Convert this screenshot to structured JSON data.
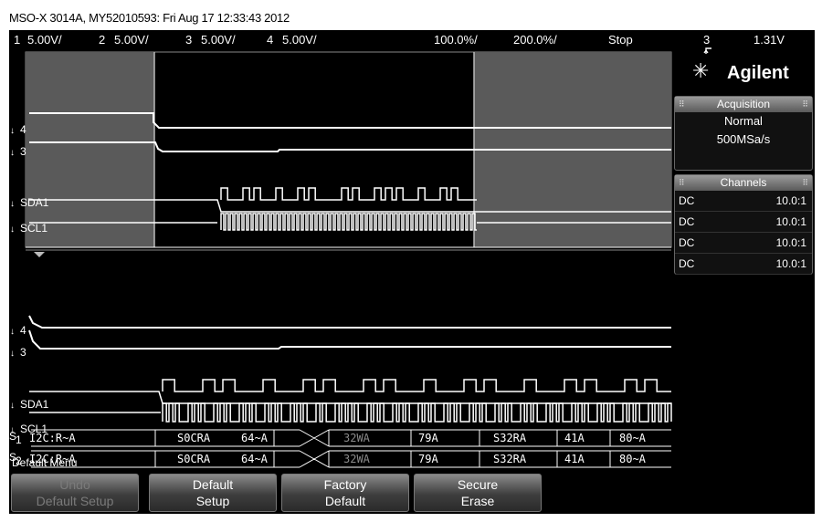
{
  "window": {
    "caption": "MSO-X 3014A, MY52010593: Fri Aug 17 12:33:43 2012"
  },
  "status_bar": {
    "ch1_num": "1",
    "ch1_scale": "5.00V/",
    "ch2_num": "2",
    "ch2_scale": "5.00V/",
    "ch3_num": "3",
    "ch3_scale": "5.00V/",
    "ch4_num": "4",
    "ch4_scale": "5.00V/",
    "timebase": "100.0%/",
    "delay": "200.0%/",
    "run_state": "Stop",
    "trigger_icon": "trigger-edge-icon",
    "trigger_source": "3",
    "trigger_level": "1.31V"
  },
  "brand": {
    "name": "Agilent",
    "logo_icon": "agilent-spark-icon"
  },
  "acquisition": {
    "title": "Acquisition",
    "mode": "Normal",
    "rate": "500MSa/s"
  },
  "channels": {
    "title": "Channels",
    "rows": [
      {
        "coupling": "DC",
        "probe": "10.0:1"
      },
      {
        "coupling": "DC",
        "probe": "10.0:1"
      },
      {
        "coupling": "DC",
        "probe": "10.0:1"
      },
      {
        "coupling": "DC",
        "probe": "10.0:1"
      }
    ]
  },
  "waveform": {
    "upper_labels": [
      "4",
      "3",
      "SDA1",
      "SCL1"
    ],
    "lower_labels": [
      "4",
      "3",
      "SDA1",
      "SCL1"
    ],
    "bus_rows": [
      {
        "name_prefix": "S",
        "name_sub": "1",
        "bus_name": "I2C:R~A",
        "packets": [
          "S0CRA",
          "64~A",
          "32WA",
          "79A",
          "S32RA",
          "41A",
          "80~A"
        ]
      },
      {
        "name_prefix": "S",
        "name_sub": "2",
        "bus_name": "I2C:R~A",
        "packets": [
          "S0CRA",
          "64~A",
          "32WA",
          "79A",
          "S32RA",
          "41A",
          "80~A"
        ]
      }
    ]
  },
  "menu": {
    "title": "Default Menu",
    "softkeys": [
      {
        "line1": "Undo",
        "line2": "Default Setup"
      },
      {
        "line1": "Default",
        "line2": "Setup"
      },
      {
        "line1": "Factory",
        "line2": "Default"
      },
      {
        "line1": "Secure",
        "line2": "Erase"
      }
    ]
  },
  "colors": {
    "background": "#000000",
    "trace": "#ffffff",
    "zoom_shade": "#5a5a5a",
    "softkey_top": "#8a8a8a",
    "disabled_text": "#7a7a7a"
  }
}
